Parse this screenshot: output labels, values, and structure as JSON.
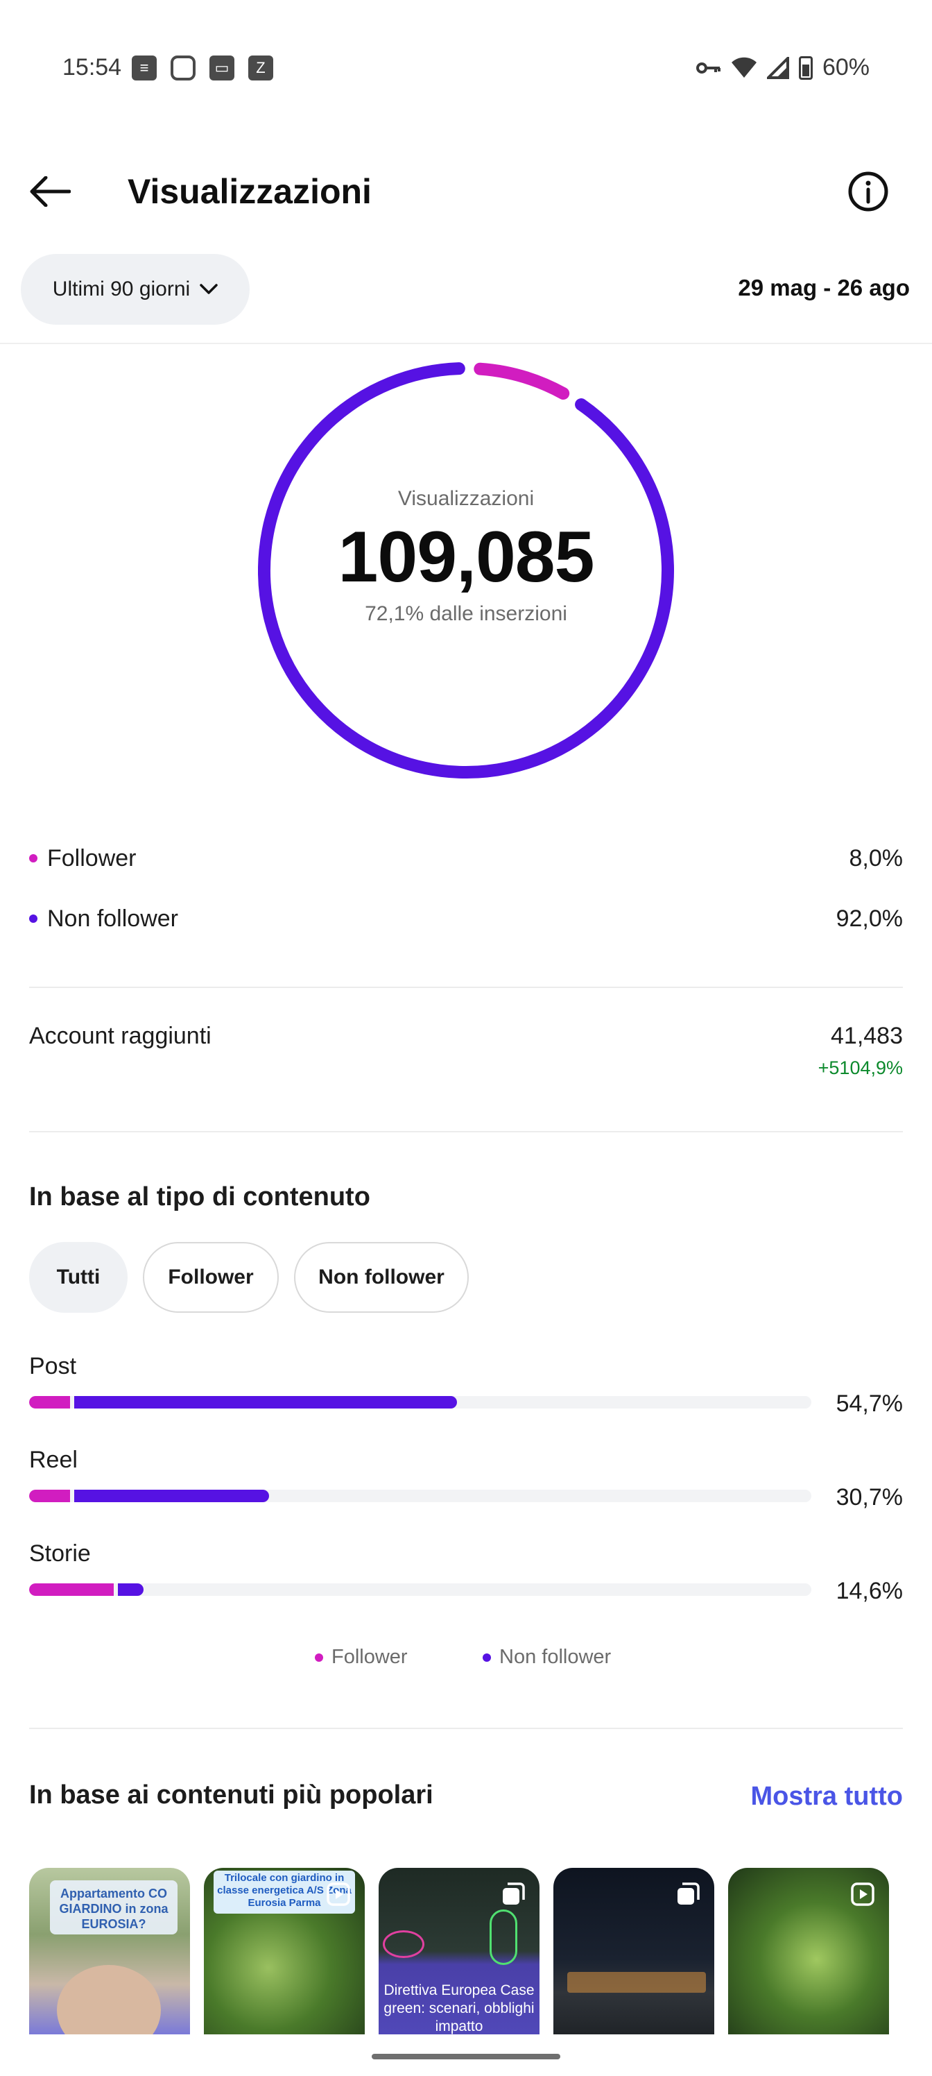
{
  "status_bar": {
    "time": "15:54",
    "battery": "60%",
    "icons": [
      "news-icon",
      "instagram-icon",
      "wallet-icon",
      "zedge-icon",
      "key-icon",
      "wifi-icon",
      "signal-icon",
      "battery-icon"
    ]
  },
  "header": {
    "title": "Visualizzazioni"
  },
  "filters": {
    "range_label": "Ultimi 90 giorni",
    "date_range": "29 mag - 26 ago"
  },
  "donut": {
    "label": "Visualizzazioni",
    "value": "109,085",
    "subtitle": "72,1% dalle inserzioni",
    "follower_fraction": 0.08,
    "non_follower_fraction": 0.92
  },
  "audience": [
    {
      "label": "Follower",
      "value": "8,0%",
      "color": "#d11dc0"
    },
    {
      "label": "Non follower",
      "value": "92,0%",
      "color": "#5612e3"
    }
  ],
  "accounts": {
    "label": "Account raggiunti",
    "value": "41,483",
    "change": "+5104,9%"
  },
  "content_type": {
    "title": "In base al tipo di contenuto",
    "tabs": [
      "Tutti",
      "Follower",
      "Non follower"
    ],
    "active_tab": "Tutti",
    "bars": [
      {
        "label": "Post",
        "pct": "54,7%",
        "total": 0.547,
        "follower_share": 0.1
      },
      {
        "label": "Reel",
        "pct": "30,7%",
        "total": 0.307,
        "follower_share": 0.18
      },
      {
        "label": "Storie",
        "pct": "14,6%",
        "total": 0.146,
        "follower_share": 0.76
      }
    ],
    "legend": [
      "Follower",
      "Non follower"
    ]
  },
  "popular": {
    "title": "In base ai contenuti più popolari",
    "show_all": "Mostra tutto",
    "thumbs": [
      {
        "text": "Appartamento CO GIARDINO in zona EUROSIA?",
        "badge": "reel-icon"
      },
      {
        "text": "Trilocale con giardino in classe energetica A/S Zona Eurosia Parma",
        "badge": "reel-icon"
      },
      {
        "text": "Direttiva Europea Case green: scenari, obblighi impatto",
        "badge": "carousel-icon"
      },
      {
        "text": "",
        "badge": "carousel-icon"
      },
      {
        "text": "",
        "badge": "reel-icon"
      }
    ]
  },
  "colors": {
    "follower": "#d11dc0",
    "non_follower": "#5612e3",
    "accent": "#4a55e6",
    "positive": "#0d8a2d"
  }
}
